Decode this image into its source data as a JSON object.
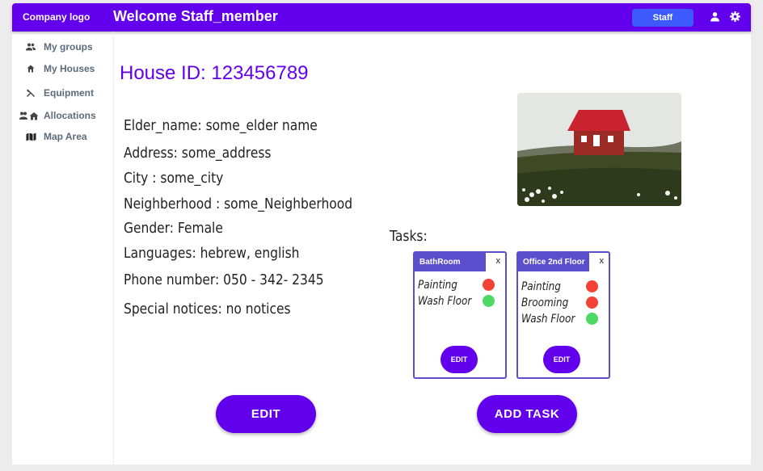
{
  "header": {
    "logo": "Company logo",
    "welcome": "Welcome Staff_member",
    "staff_button": "Staff",
    "icons": [
      "person-icon",
      "gear-icon"
    ],
    "bar_color": "#6200ee"
  },
  "sidebar": {
    "items": [
      {
        "label": "My groups",
        "icon": "group-icon"
      },
      {
        "label": "My Houses",
        "icon": "home-icon"
      },
      {
        "label": "Equipment",
        "icon": "tools-icon"
      },
      {
        "label": "Allocations",
        "icon": "people-home-icon"
      },
      {
        "label": "Map Area",
        "icon": "map-icon"
      }
    ]
  },
  "house": {
    "id_label": "House ID: 123456789",
    "fields": [
      "Elder_name: some_elder name",
      "Address: some_address",
      "City : some_city",
      "Neighberhood : some_Neighberhood",
      "Gender: Female",
      "Languages: hebrew, english",
      "Phone number: 050 - 342- 2345",
      "Special notices: no notices"
    ]
  },
  "tasks": {
    "label": "Tasks:",
    "cards": [
      {
        "title": "BathRoom",
        "close": "x",
        "items": [
          {
            "name": "Painting",
            "status": "red"
          },
          {
            "name": "Wash Floor",
            "status": "green"
          }
        ],
        "edit": "EDIT"
      },
      {
        "title": "Office 2nd Floor",
        "close": "x",
        "items": [
          {
            "name": "Painting",
            "status": "red"
          },
          {
            "name": "Brooming",
            "status": "red"
          },
          {
            "name": "Wash Floor",
            "status": "green"
          }
        ],
        "edit": "EDIT"
      }
    ],
    "status_colors": {
      "red": "#f44336",
      "green": "#4cd964"
    }
  },
  "actions": {
    "edit": "EDIT",
    "add_task": "ADD TASK"
  }
}
